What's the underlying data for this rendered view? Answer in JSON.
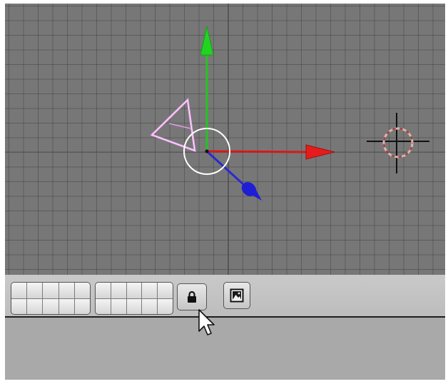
{
  "window": {
    "title": "",
    "accent_colors": {
      "x_axis": "#e01818",
      "y_axis": "#19c419",
      "z_axis": "#1f1fd6",
      "camera": "#e8a0e8",
      "grid_bg": "#777777"
    }
  },
  "viewport": {
    "view": "3D View",
    "icons": [
      "camera-icon",
      "transform-manipulator-icon",
      "3d-cursor-icon"
    ]
  },
  "header": {
    "layers_group_1": {
      "rows": 2,
      "columns": 5,
      "active_layers": []
    },
    "layers_group_2": {
      "rows": 2,
      "columns": 5,
      "active_layers": []
    },
    "lock_button": {
      "icon": "lock-icon"
    },
    "render_button": {
      "icon": "image-icon"
    }
  },
  "pointer": {
    "icon": "arrow-cursor-icon"
  }
}
